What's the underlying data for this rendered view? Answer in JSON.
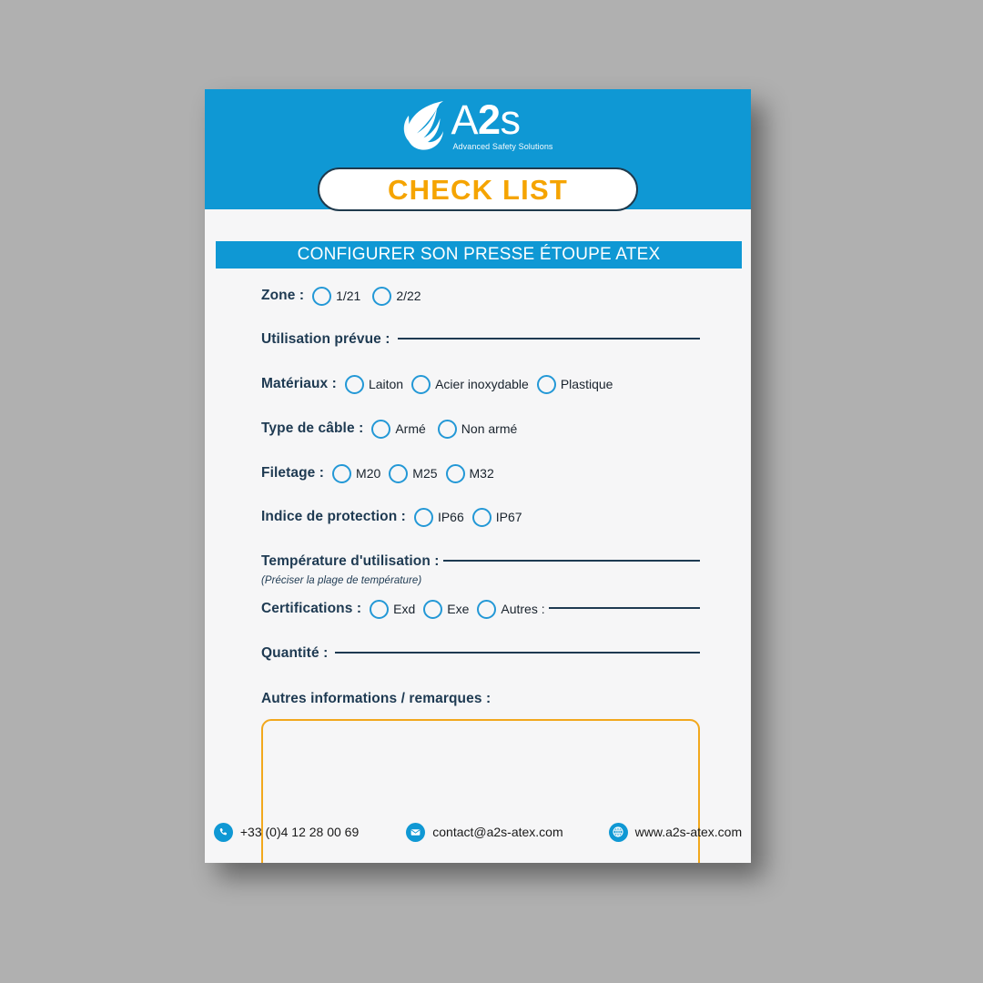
{
  "document": {
    "brand": {
      "logo_icon": "leaf-flame-logo-icon",
      "name_part1": "A",
      "name_part2": "2",
      "name_part3": "s",
      "tagline": "Advanced Safety Solutions"
    },
    "title_pill": "CHECK LIST",
    "section_title": "CONFIGURER SON PRESSE ÉTOUPE ATEX",
    "colors": {
      "brand_blue": "#0f98d4",
      "radio_blue": "#2398d6",
      "navy": "#1e3a52",
      "orange": "#f5a400",
      "remark_border": "#f2a81d",
      "page_bg": "#f6f6f7",
      "backdrop": "#b0b0b0"
    },
    "fields": [
      {
        "id": "zone",
        "label": "Zone :",
        "type": "radio-group",
        "options": [
          "1/21",
          "2/22"
        ]
      },
      {
        "id": "utilisation-prevue",
        "label": "Utilisation prévue :",
        "type": "write-in-line",
        "value": ""
      },
      {
        "id": "materiaux",
        "label": "Matériaux :",
        "type": "radio-group",
        "options": [
          "Laiton",
          "Acier inoxydable",
          "Plastique"
        ]
      },
      {
        "id": "type-de-cable",
        "label": "Type de câble :",
        "type": "radio-group",
        "options": [
          "Armé",
          "Non armé"
        ]
      },
      {
        "id": "filetage",
        "label": "Filetage :",
        "type": "radio-group",
        "options": [
          "M20",
          "M25",
          "M32"
        ]
      },
      {
        "id": "indice-de-protection",
        "label": "Indice de protection :",
        "type": "radio-group",
        "options": [
          "IP66",
          "IP67"
        ]
      },
      {
        "id": "temperature-utilisation",
        "label": "Température d'utilisation :",
        "type": "write-in-line",
        "hint": "(Préciser la plage de température)",
        "value": ""
      },
      {
        "id": "certifications",
        "label": "Certifications :",
        "type": "radio-group-with-other",
        "options": [
          "Exd",
          "Exe"
        ],
        "other_label": "Autres :",
        "other_value": ""
      },
      {
        "id": "quantite",
        "label": "Quantité :",
        "type": "write-in-line",
        "value": ""
      },
      {
        "id": "autres-informations",
        "label": "Autres informations / remarques :",
        "type": "textarea",
        "value": ""
      }
    ],
    "footer": {
      "phone": {
        "icon": "phone-icon",
        "text": "+33 (0)4 12 28 00 69"
      },
      "email": {
        "icon": "envelope-icon",
        "text": "contact@a2s-atex.com"
      },
      "website": {
        "icon": "globe-icon",
        "text": "www.a2s-atex.com"
      }
    }
  }
}
